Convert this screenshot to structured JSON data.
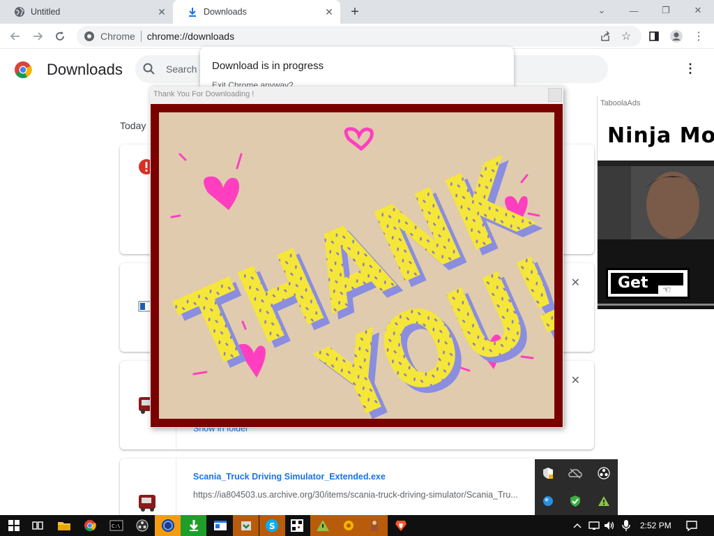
{
  "browser": {
    "tabs": [
      {
        "title": "Untitled",
        "icon": "globe-icon"
      },
      {
        "title": "Downloads",
        "icon": "download-icon",
        "active": true
      }
    ],
    "omnibox": {
      "site": "Chrome",
      "url": "chrome://downloads"
    }
  },
  "downloads_page": {
    "title": "Downloads",
    "search_placeholder": "Search d",
    "date_group": "Today",
    "items": [
      {
        "file": "Scania_Truck Driving Simulator_Extended.exe",
        "url": "https://ia804503.us.archive.org/30/items/scania-truck-driving-simulator/Scania_Tru...",
        "action": "Show in folder"
      }
    ]
  },
  "chrome_dialog": {
    "title": "Download is in progress",
    "subtitle": "Exit Chrome anyway?"
  },
  "popup": {
    "title": "Thank You For Downloading !",
    "art_text": [
      "THANK",
      "YOU!"
    ]
  },
  "ad": {
    "label": "TaboolaAds",
    "headline": "Ninja Mov",
    "cta": "Get"
  },
  "taskbar": {
    "time": "2:52 PM"
  },
  "colors": {
    "tab_strip": "#dee1e6",
    "popup_frame": "#7a0000",
    "art_bg": "#e0cbaf",
    "art_letters": "#f5e63a",
    "art_shadow": "#8a8de0",
    "art_hearts": "#ff3fbf",
    "link_blue": "#1a73e8"
  }
}
